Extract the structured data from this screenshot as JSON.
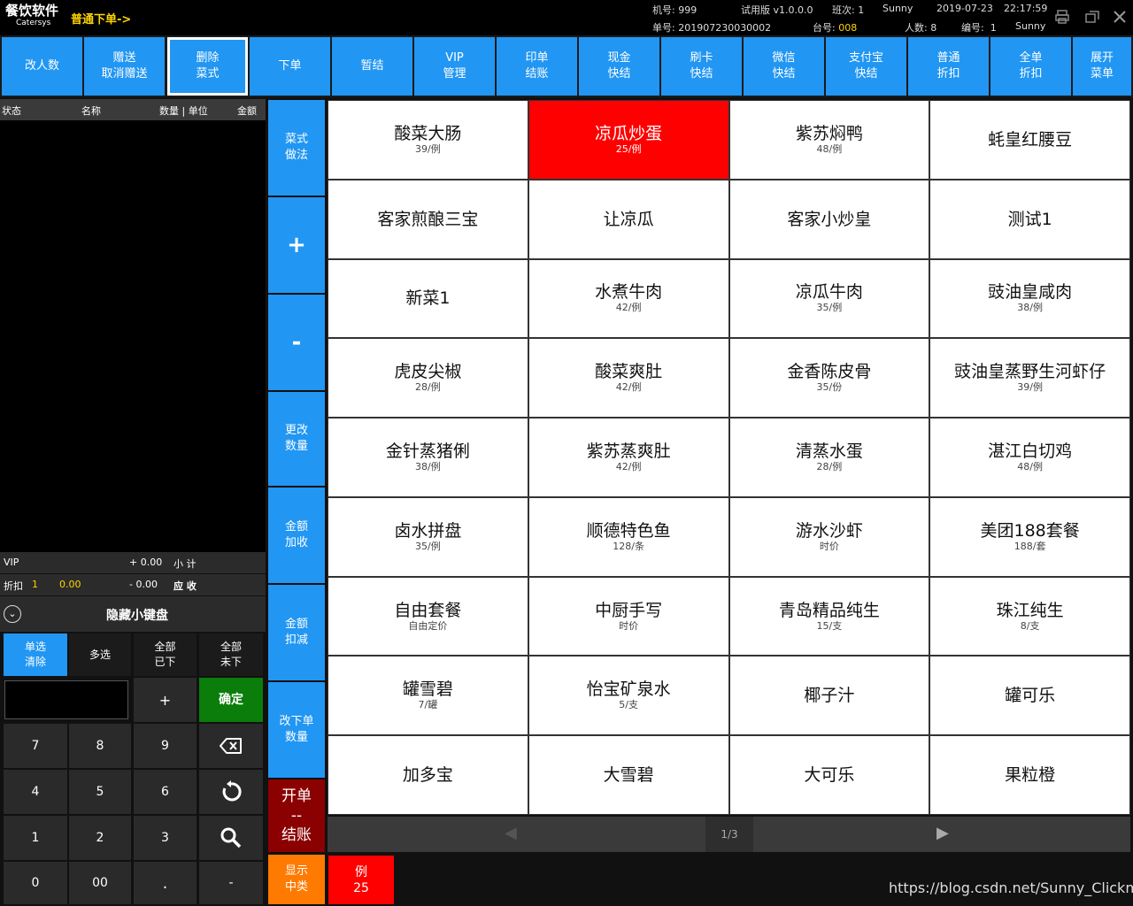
{
  "header": {
    "brand_title": "餐饮软件",
    "brand_sub": "Catersys",
    "mode": "普通下单->",
    "machine": "机号: 999",
    "version": "试用版 v1.0.0.0",
    "shift": "班次: 1",
    "user": "Sunny",
    "date": "2019-07-23",
    "time": "22:17:59",
    "order_no": "单号: 201907230030002",
    "table_label": "台号:",
    "table_value": "008",
    "people": "人数: 8",
    "staff_no_label": "编号:",
    "staff_no": "1",
    "staff_name": "Sunny"
  },
  "toolbar": [
    {
      "label": "改人数"
    },
    {
      "label": "赠送\n取消赠送"
    },
    {
      "label": "删除\n菜式",
      "active": true
    },
    {
      "label": "下单"
    },
    {
      "label": "暂结"
    },
    {
      "label": "VIP\n管理"
    },
    {
      "label": "印单\n结账"
    },
    {
      "label": "现金\n快结"
    },
    {
      "label": "刷卡\n快结"
    },
    {
      "label": "微信\n快结"
    },
    {
      "label": "支付宝\n快结"
    },
    {
      "label": "普通\n折扣"
    },
    {
      "label": "全单\n折扣"
    },
    {
      "label": "展开\n菜单"
    }
  ],
  "order": {
    "col_status": "状态",
    "col_name": "名称",
    "col_qty": "数量 | 单位",
    "col_amount": "金额",
    "vip_label": "VIP",
    "plus_amount": "+ 0.00",
    "subtotal_label": "小 计",
    "discount_label": "折扣",
    "discount_rate": "1",
    "discount_value": "0.00",
    "minus_amount": "- 0.00",
    "due_label": "应 收"
  },
  "keyboard": {
    "toggle_label": "隐藏小键盘",
    "single": "单选\n清除",
    "multi": "多选",
    "all_done": "全部\n已下",
    "all_pending": "全部\n未下",
    "plus": "+",
    "confirm": "确定",
    "keys": [
      "7",
      "8",
      "9",
      "4",
      "5",
      "6",
      "1",
      "2",
      "3",
      "0",
      "00",
      ".",
      "-"
    ]
  },
  "side": {
    "method": "菜式\n做法",
    "plus": "+",
    "minus": "-",
    "change_qty": "更改\n数量",
    "amount_add": "金额\n加收",
    "amount_sub": "金额\n扣减",
    "change_order_qty": "改下单\n数量",
    "open_pay": "开单\n--\n结账",
    "show_mid": "显示\n中类"
  },
  "dishes": [
    {
      "name": "酸菜大肠",
      "price": "39/例"
    },
    {
      "name": "凉瓜炒蛋",
      "price": "25/例",
      "selected": true
    },
    {
      "name": "紫苏焖鸭",
      "price": "48/例"
    },
    {
      "name": "蚝皇红腰豆",
      "price": ""
    },
    {
      "name": "客家煎酿三宝",
      "price": ""
    },
    {
      "name": "让凉瓜",
      "price": ""
    },
    {
      "name": "客家小炒皇",
      "price": ""
    },
    {
      "name": "测试1",
      "price": ""
    },
    {
      "name": "新菜1",
      "price": ""
    },
    {
      "name": "水煮牛肉",
      "price": "42/例"
    },
    {
      "name": "凉瓜牛肉",
      "price": "35/例"
    },
    {
      "name": "豉油皇咸肉",
      "price": "38/例"
    },
    {
      "name": "虎皮尖椒",
      "price": "28/例"
    },
    {
      "name": "酸菜爽肚",
      "price": "42/例"
    },
    {
      "name": "金香陈皮骨",
      "price": "35/份"
    },
    {
      "name": "豉油皇蒸野生河虾仔",
      "price": "39/例"
    },
    {
      "name": "金针蒸猪俐",
      "price": "38/例"
    },
    {
      "name": "紫苏蒸爽肚",
      "price": "42/例"
    },
    {
      "name": "清蒸水蛋",
      "price": "28/例"
    },
    {
      "name": "湛江白切鸡",
      "price": "48/例"
    },
    {
      "name": "卤水拼盘",
      "price": "35/例"
    },
    {
      "name": "顺德特色鱼",
      "price": "128/条"
    },
    {
      "name": "游水沙虾",
      "price": "时价"
    },
    {
      "name": "美团188套餐",
      "price": "188/套"
    },
    {
      "name": "自由套餐",
      "price": "自由定价"
    },
    {
      "name": "中厨手写",
      "price": "时价"
    },
    {
      "name": "青岛精品纯生",
      "price": "15/支"
    },
    {
      "name": "珠江纯生",
      "price": "8/支"
    },
    {
      "name": "罐雪碧",
      "price": "7/罐"
    },
    {
      "name": "怡宝矿泉水",
      "price": "5/支"
    },
    {
      "name": "椰子汁",
      "price": ""
    },
    {
      "name": "罐可乐",
      "price": ""
    },
    {
      "name": "加多宝",
      "price": ""
    },
    {
      "name": "大雪碧",
      "price": ""
    },
    {
      "name": "大可乐",
      "price": ""
    },
    {
      "name": "果粒橙",
      "price": ""
    }
  ],
  "pager": {
    "page": "1/3",
    "prev_icon": "chevron-left-icon",
    "next_icon": "chevron-right-icon"
  },
  "unit_chip": {
    "unit": "例",
    "price": "25"
  },
  "watermark": "https://blog.csdn.net/Sunny_Clickman",
  "colors": {
    "accent": "#2196f3",
    "selected": "#ff0000",
    "confirm": "#0a7d0a",
    "open_pay": "#8b0000",
    "show_mid": "#ff7a00",
    "highlight_text": "#ffd400"
  }
}
